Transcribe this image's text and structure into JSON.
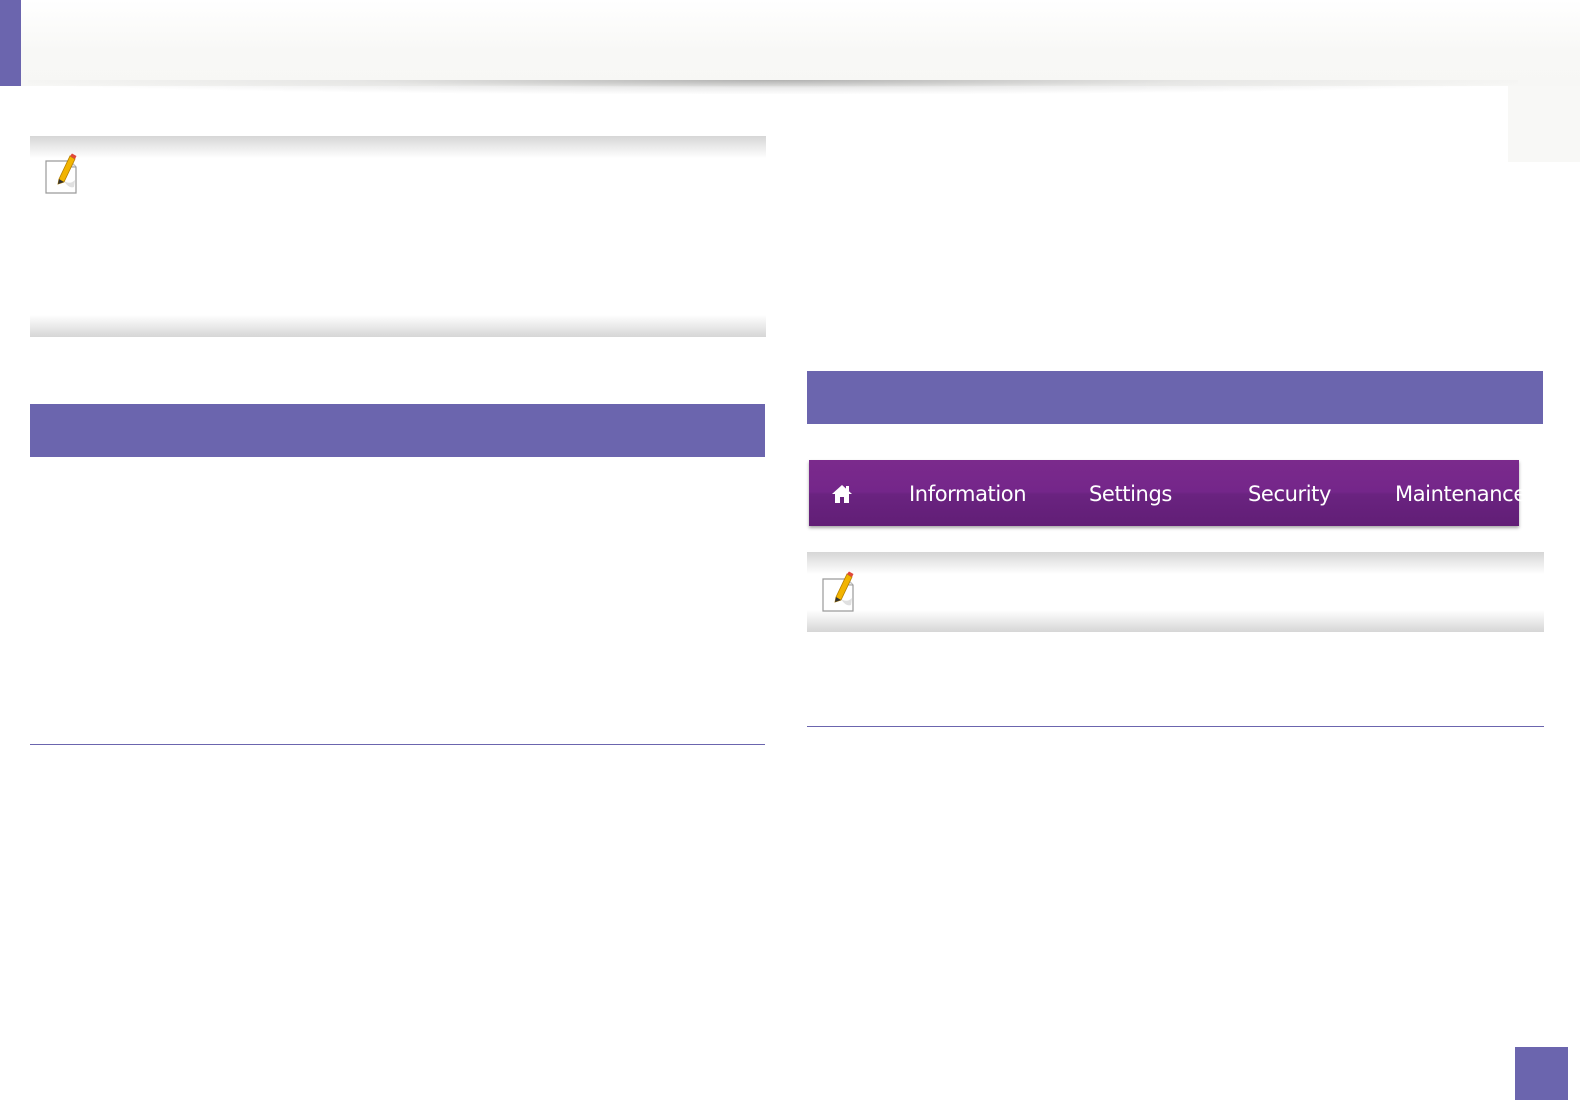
{
  "colors": {
    "accent": "#6b65ae",
    "nav_bar": "#6f2585",
    "nav_text": "#ffffff",
    "note_shade": "#d6d6d6",
    "header_wash": "#f8f8f6"
  },
  "icons": {
    "note_icon": "note-pencil-icon",
    "home_icon": "home-icon"
  },
  "nav": {
    "items": [
      {
        "label": "Information"
      },
      {
        "label": "Settings"
      },
      {
        "label": "Security"
      },
      {
        "label": "Maintenance"
      }
    ]
  }
}
